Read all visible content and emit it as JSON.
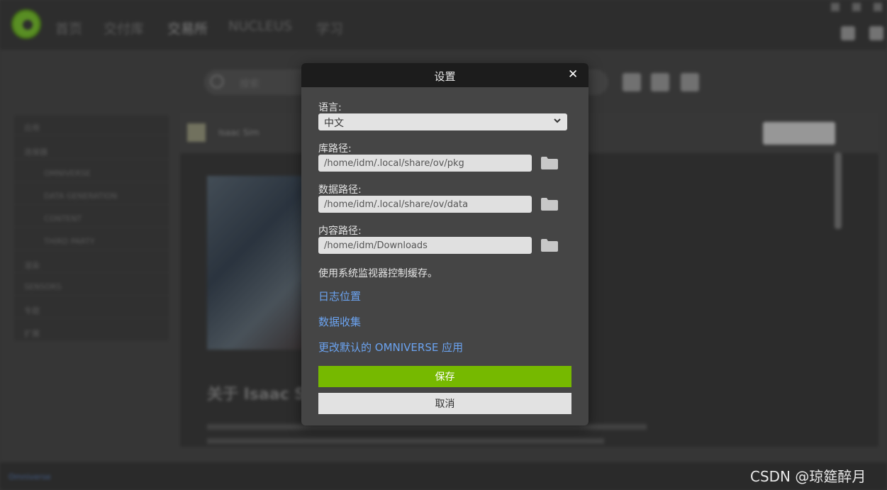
{
  "background": {
    "nav": [
      "首页",
      "交付库",
      "交易所",
      "NUCLEUS",
      "学习"
    ],
    "search_placeholder": "搜索",
    "sidebar_items": [
      "应用",
      "连接器",
      "OMNIVERSE",
      "DATA GENERATION",
      "CONTENT",
      "THIRD PARTY",
      "渲染",
      "SENSORS",
      "专题",
      "扩展"
    ],
    "main_title": "Isaac Sim",
    "heading": "关于 Isaac Sim",
    "bottom_link": "Omniverse"
  },
  "dialog": {
    "title": "设置",
    "language_label": "语言:",
    "language_value": "中文",
    "library_path_label": "库路径:",
    "library_path_value": "/home/idm/.local/share/ov/pkg",
    "data_path_label": "数据路径:",
    "data_path_value": "/home/idm/.local/share/ov/data",
    "content_path_label": "内容路径:",
    "content_path_value": "/home/idm/Downloads",
    "cache_info": "使用系统监视器控制缓存。",
    "log_location_link": "日志位置",
    "data_collection_link": "数据收集",
    "change_default_app_link": "更改默认的 OMNIVERSE 应用",
    "save_label": "保存",
    "cancel_label": "取消"
  },
  "watermark": "CSDN @琼筵醉月",
  "colors": {
    "accent_green": "#76b900",
    "link_blue": "#6ba3f0",
    "dialog_bg": "#454545",
    "titlebar_bg": "#1c1c1c"
  }
}
